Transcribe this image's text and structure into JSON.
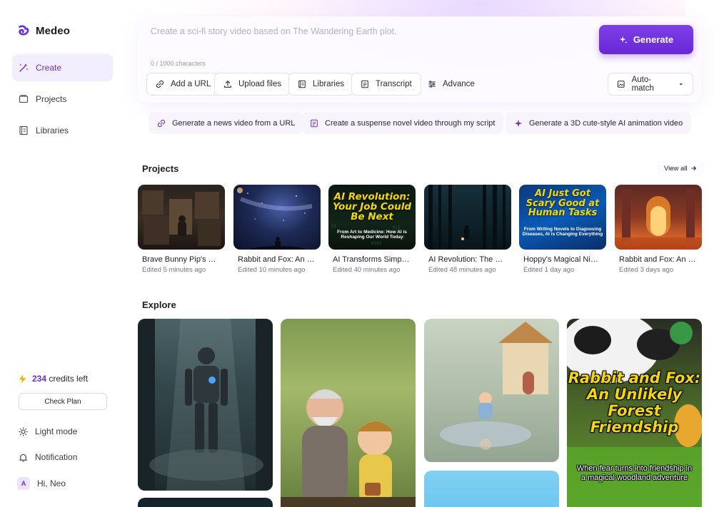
{
  "app": {
    "name": "Medeo"
  },
  "sidebar": {
    "items": [
      {
        "label": "Create",
        "icon": "wand-icon",
        "active": true
      },
      {
        "label": "Projects",
        "icon": "folder-icon"
      },
      {
        "label": "Libraries",
        "icon": "library-icon"
      }
    ],
    "credits_count": "234",
    "credits_text": "credits left",
    "check_plan": "Check Plan",
    "light_mode": "Light mode",
    "notification": "Notification",
    "avatar_initial": "A",
    "greeting": "Hi, Neo"
  },
  "prompt": {
    "placeholder": "Create a sci-fi story video based on The Wandering Earth plot.",
    "counter": "0 / 1000 characters",
    "generate": "Generate",
    "tools": [
      "Add a URL",
      "Upload files",
      "Libraries",
      "Transcript",
      "Advance"
    ],
    "auto_match": "Auto-match"
  },
  "suggestions": [
    "Generate a news video from a URL",
    "Create a suspense novel video through my script",
    "Generate a 3D cute-style AI animation video"
  ],
  "projects": {
    "title": "Projects",
    "view_all": "View all",
    "items": [
      {
        "title": "Brave Bunny Pip's First...",
        "time": "Edited 5 minutes ago"
      },
      {
        "title": "Rabbit and Fox: An Unlikely...",
        "time": "Edited 10 minutes ago"
      },
      {
        "title": "AI Transforms Simple...",
        "time": "Edited 40 minutes ago",
        "caption": "AI Revolution: Your Job Could Be Next",
        "sub": "From Art to Medicine: How AI is Reshaping Our World Today"
      },
      {
        "title": "AI Revolution: The Future...",
        "time": "Edited 48 minutes ago"
      },
      {
        "title": "Hoppy's Magical Night...",
        "time": "Edited 1 day ago",
        "caption": "AI Just Got Scary Good at Human Tasks",
        "sub": "From Writing Novels to Diagnosing Diseases, AI is Changing Everything"
      },
      {
        "title": "Rabbit and Fox: An Unlikely...",
        "time": "Edited 3 days ago"
      }
    ]
  },
  "explore": {
    "title": "Explore",
    "feature_caption": "Rabbit and Fox: An Unlikely Forest Friendship",
    "feature_sub": "When fear turns into friendship in a magical woodland adventure"
  },
  "colors": {
    "accent": "#6b2fd6",
    "caption_yellow": "#f4d70b"
  }
}
